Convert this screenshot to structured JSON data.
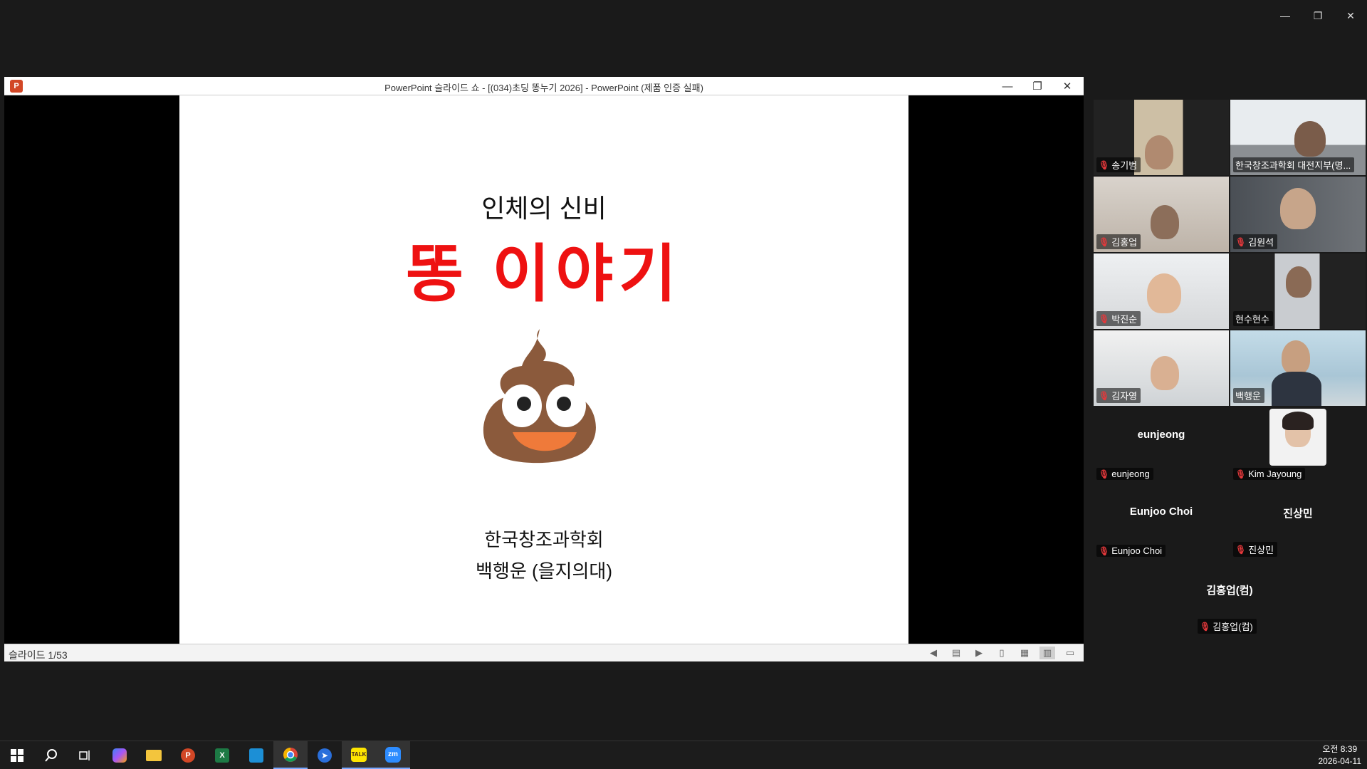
{
  "zoom_window": {
    "minimize": "—",
    "restore": "❐",
    "close": "✕"
  },
  "ppt": {
    "title": "PowerPoint 슬라이드 쇼 - [(034)초딩 똥누기 2026] - PowerPoint (제품 인증 실패)",
    "status": "슬라이드 1/53",
    "slide": {
      "subtitle": "인체의 신비",
      "title": "똥 이야기",
      "org": "한국창조과학회",
      "author": "백행운 (을지의대)"
    }
  },
  "participants": [
    {
      "name": "송기범",
      "muted": true,
      "video": true
    },
    {
      "name": "한국창조과학회 대전지부(명...",
      "muted": false,
      "video": true
    },
    {
      "name": "김홍업",
      "muted": true,
      "video": true
    },
    {
      "name": "김원석",
      "muted": true,
      "video": true
    },
    {
      "name": "박진순",
      "muted": true,
      "video": true
    },
    {
      "name": "현수현수",
      "muted": false,
      "video": true
    },
    {
      "name": "김자영",
      "muted": true,
      "video": true
    },
    {
      "name": "백행운",
      "muted": false,
      "video": true,
      "active": true
    },
    {
      "name": "eunjeong",
      "display": "eunjeong",
      "muted": true,
      "video": false
    },
    {
      "name": "Kim Jayoung",
      "muted": true,
      "video": false
    },
    {
      "name": "Eunjoo Choi",
      "display": "Eunjoo Choi",
      "muted": true,
      "video": false
    },
    {
      "name": "진상민",
      "display": "진상민",
      "muted": true,
      "video": false
    },
    {
      "name": "김홍업(컴)",
      "display": "김홍업(컴)",
      "muted": true,
      "video": false
    }
  ],
  "taskbar": {
    "items": [
      "windows-start",
      "search",
      "task-view",
      "copilot",
      "file-explorer",
      "powerpoint",
      "excel",
      "app-blue",
      "chrome",
      "app-arrow",
      "kakaotalk",
      "zoom"
    ],
    "time": "오전 8:39",
    "date": "2026-04-11"
  },
  "colors": {
    "title_red": "#ee1111",
    "active_speaker": "#3ddc84",
    "mute_red": "#e5383b"
  }
}
